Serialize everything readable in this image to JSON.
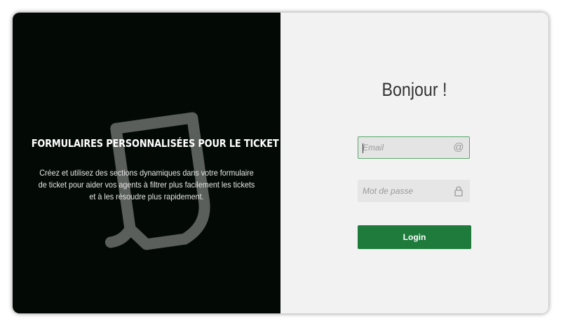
{
  "promo": {
    "title": "FORMULAIRES PERSONNALISÉES POUR LE TICKET",
    "description_lines": [
      "Créez et utilisez des sections dynamiques dans votre formulaire",
      "de ticket pour aider vos agents à filtrer plus facilement les tickets",
      "et à les résoudre plus rapidement."
    ],
    "illustration_icon": "ticket-illustration-icon"
  },
  "login": {
    "greeting": "Bonjour !",
    "email": {
      "placeholder": "Email",
      "value": "",
      "icon": "at-icon",
      "icon_glyph": "@"
    },
    "password": {
      "placeholder": "Mot de passe",
      "value": "",
      "icon": "lock-icon"
    },
    "submit_label": "Login"
  },
  "colors": {
    "left_background": "#030a05",
    "right_background": "#f2f2f2",
    "accent": "#1e7b3c",
    "focus_border": "#5aa86a"
  }
}
